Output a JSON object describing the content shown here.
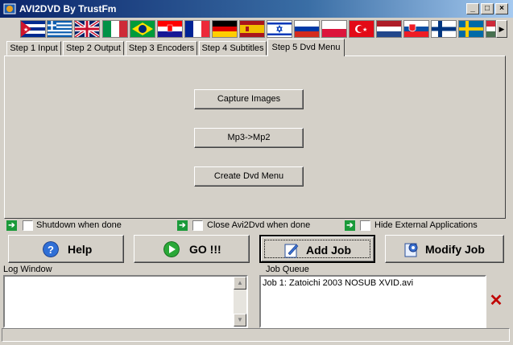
{
  "window": {
    "title": "AVI2DVD By TrustFm"
  },
  "title_buttons": {
    "minimize": "_",
    "maximize": "□",
    "close": "×"
  },
  "languages": [
    {
      "name": "cuba-flag"
    },
    {
      "name": "greece-flag"
    },
    {
      "name": "uk-flag"
    },
    {
      "name": "italy-flag"
    },
    {
      "name": "brazil-flag"
    },
    {
      "name": "croatia-flag"
    },
    {
      "name": "france-flag"
    },
    {
      "name": "germany-flag"
    },
    {
      "name": "spain-flag"
    },
    {
      "name": "israel-flag"
    },
    {
      "name": "russia-flag"
    },
    {
      "name": "poland-flag"
    },
    {
      "name": "turkey-flag"
    },
    {
      "name": "netherlands-flag"
    },
    {
      "name": "slovakia-flag"
    },
    {
      "name": "finland-flag"
    },
    {
      "name": "sweden-flag"
    },
    {
      "name": "hungary-flag"
    }
  ],
  "flag_scroll": "▶",
  "tabs": [
    {
      "label": "Step 1 Input"
    },
    {
      "label": "Step 2 Output"
    },
    {
      "label": "Step 3 Encoders"
    },
    {
      "label": "Step 4 Subtitles"
    },
    {
      "label": "Step 5 Dvd Menu"
    }
  ],
  "panel": {
    "capture_images": "Capture Images",
    "mp3_to_mp2": "Mp3->Mp2",
    "create_dvd_menu": "Create Dvd Menu"
  },
  "options": {
    "shutdown": "Shutdown when done",
    "close_app": "Close Avi2Dvd when done",
    "hide_external": "Hide External Applications"
  },
  "actions": {
    "help": "Help",
    "go": "GO !!!",
    "add_job": "Add Job",
    "modify_job": "Modify Job"
  },
  "log_window": {
    "label": "Log Window"
  },
  "job_queue": {
    "label": "Job Queue",
    "items": [
      "Job 1: Zatoichi 2003 NOSUB XVID.avi"
    ]
  },
  "delete_symbol": "✕"
}
